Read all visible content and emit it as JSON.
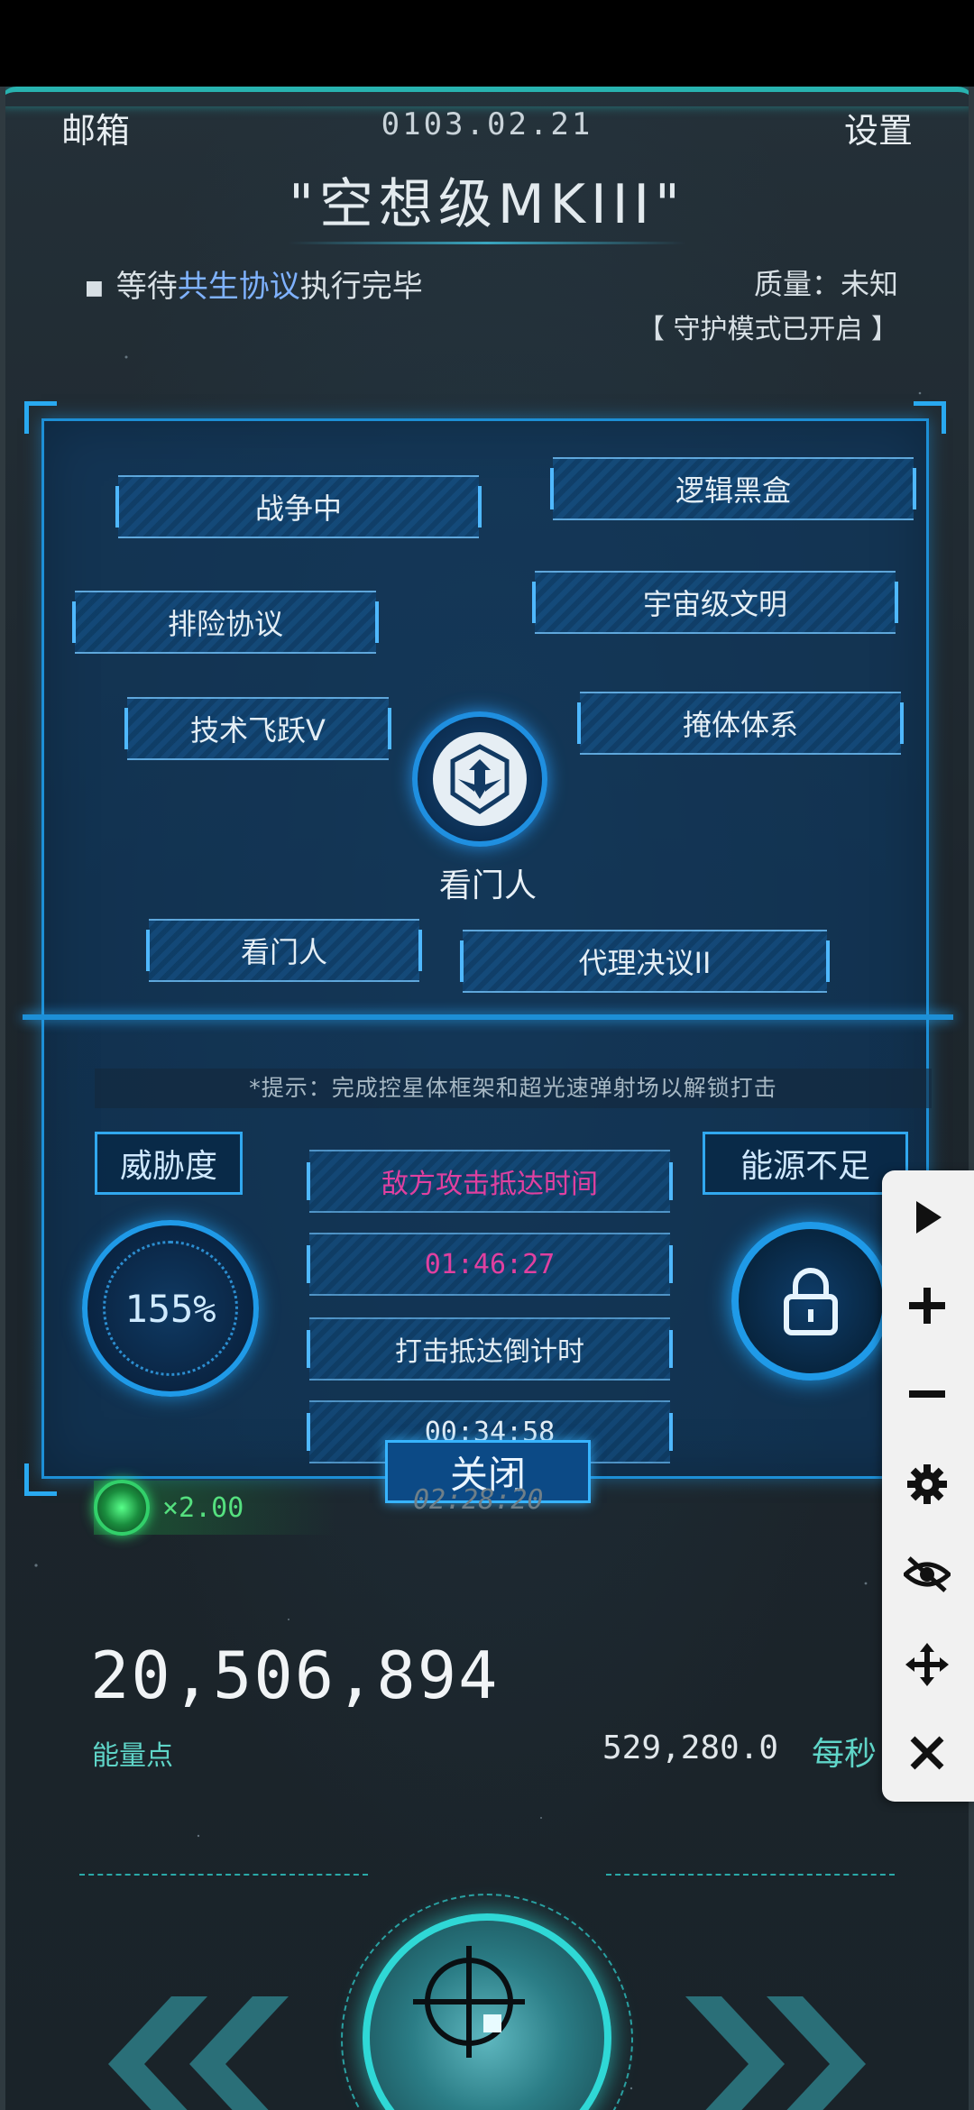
{
  "header": {
    "mail_label": "邮箱",
    "date": "0103.02.21",
    "settings_label": "设置",
    "ship_name": "\"空想级MKIII\""
  },
  "status": {
    "prefix": "等待",
    "highlight": "共生协议",
    "suffix": "执行完毕",
    "quality": "质量：未知",
    "guard_mode": "【 守护模式已开启 】"
  },
  "panel": {
    "tags": [
      "战争中",
      "逻辑黑盒",
      "排险协议",
      "宇宙级文明",
      "技术飞跃V",
      "掩体体系",
      "看门人",
      "代理决议II"
    ],
    "emblem_label": "看门人",
    "hint": "*提示：完成控星体框架和超光速弹射场以解锁打击",
    "threat_label": "威胁度",
    "threat_value": "155%",
    "energy_status": "能源不足",
    "enemy_arrival_label": "敌方攻击抵达时间",
    "enemy_arrival_time": "01:46:27",
    "strike_countdown_label": "打击抵达倒计时",
    "strike_countdown_time": "00:34:58",
    "close_label": "关闭"
  },
  "hud": {
    "multiplier": "×2.00",
    "timer_partial": "02:28:20",
    "energy_value": "20,506,894",
    "energy_label": "能量点",
    "rate_value": "529,280.0",
    "rate_unit": "每秒"
  },
  "colors": {
    "accent_teal": "#2fd8d6",
    "panel_blue": "#1d8fd6",
    "enemy_text": "#e040a0",
    "multiplier_green": "#55e07f",
    "highlight_blue": "#7fb2ff"
  },
  "toolbar": {
    "icons": [
      "play-icon",
      "plus-icon",
      "minus-icon",
      "gear-icon",
      "eye-off-icon",
      "move-icon",
      "close-icon"
    ]
  }
}
